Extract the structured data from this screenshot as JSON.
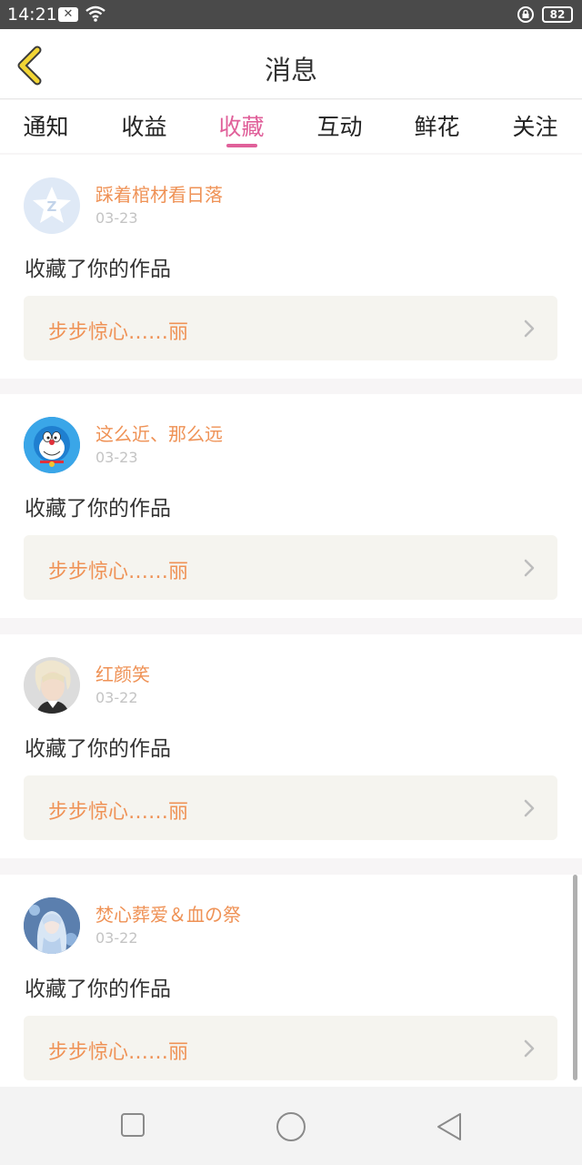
{
  "status_bar": {
    "time": "14:21",
    "battery": "82"
  },
  "header": {
    "title": "消息"
  },
  "tabs": [
    {
      "label": "通知",
      "active": false
    },
    {
      "label": "收益",
      "active": false
    },
    {
      "label": "收藏",
      "active": true
    },
    {
      "label": "互动",
      "active": false
    },
    {
      "label": "鲜花",
      "active": false
    },
    {
      "label": "关注",
      "active": false
    }
  ],
  "messages": [
    {
      "user": "踩着棺材看日落",
      "date": "03-23",
      "text": "收藏了你的作品",
      "work": "步步惊心……丽"
    },
    {
      "user": "这么近、那么远",
      "date": "03-23",
      "text": "收藏了你的作品",
      "work": "步步惊心……丽"
    },
    {
      "user": "红颜笑",
      "date": "03-22",
      "text": "收藏了你的作品",
      "work": "步步惊心……丽"
    },
    {
      "user": "焚心葬爱＆血の祭",
      "date": "03-22",
      "text": "收藏了你的作品",
      "work": "步步惊心……丽"
    }
  ],
  "colors": {
    "accent_pink": "#e0609a",
    "username_orange": "#ef9256",
    "back_arrow_yellow": "#f2d535"
  }
}
